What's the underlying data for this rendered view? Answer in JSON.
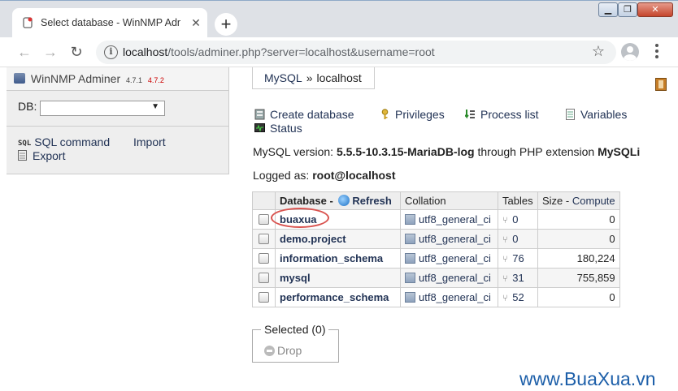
{
  "browser": {
    "tab_title": "Select database - WinNMP Admin",
    "tab_close": "✕",
    "new_tab": "+",
    "url_host": "localhost",
    "url_rest": "/tools/adminer.php?server=localhost&username=root",
    "window_buttons": {
      "minimize": "▁",
      "maximize": "❐",
      "close": "✕"
    }
  },
  "sidebar": {
    "app_title": "WinNMP Adminer",
    "version_current": "4.7.1",
    "version_new": "4.7.2",
    "db_label": "DB:",
    "db_select_value": "",
    "sql_badge": "SQL",
    "links": {
      "sql_command": "SQL command",
      "import": "Import",
      "export": "Export"
    }
  },
  "breadcrumb": {
    "server": "MySQL",
    "separator": "»",
    "current": "localhost"
  },
  "actions": {
    "create_database": "Create database",
    "privileges": "Privileges",
    "process_list": "Process list",
    "variables": "Variables",
    "status": "Status"
  },
  "info": {
    "version_prefix": "MySQL version:",
    "version": "5.5.5-10.3.15-MariaDB-log",
    "through": "through PHP extension",
    "extension": "MySQLi",
    "logged_prefix": "Logged as:",
    "user": "root@localhost"
  },
  "table": {
    "headers": {
      "database": "Database",
      "dash": "-",
      "refresh": "Refresh",
      "collation": "Collation",
      "tables": "Tables",
      "size": "Size",
      "size_dash": "-",
      "compute": "Compute"
    },
    "rows": [
      {
        "name": "buaxua",
        "collation": "utf8_general_ci",
        "tables": "0",
        "size": "0"
      },
      {
        "name": "demo.project",
        "collation": "utf8_general_ci",
        "tables": "0",
        "size": "0"
      },
      {
        "name": "information_schema",
        "collation": "utf8_general_ci",
        "tables": "76",
        "size": "180,224"
      },
      {
        "name": "mysql",
        "collation": "utf8_general_ci",
        "tables": "31",
        "size": "755,859"
      },
      {
        "name": "performance_schema",
        "collation": "utf8_general_ci",
        "tables": "52",
        "size": "0"
      }
    ]
  },
  "selected": {
    "legend": "Selected (0)",
    "drop": "Drop"
  },
  "watermark": "www.BuaXua.vn",
  "colors": {
    "link": "#223355",
    "version_new": "#cc0000",
    "highlight": "#d9534f",
    "watermark": "#1d5fa9"
  }
}
